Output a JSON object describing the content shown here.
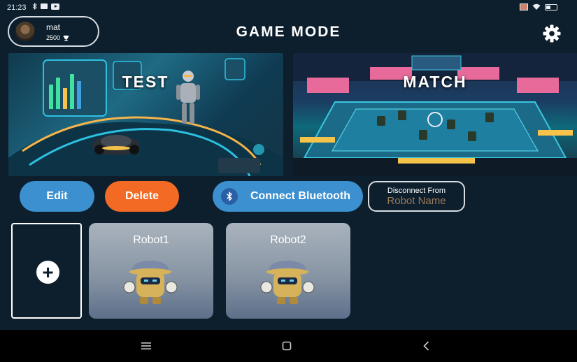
{
  "status_bar": {
    "time": "21:23"
  },
  "profile": {
    "name": "mat",
    "score": "2500"
  },
  "header": {
    "title": "GAME MODE"
  },
  "modes": [
    {
      "label": "TEST"
    },
    {
      "label": "MATCH"
    }
  ],
  "actions": {
    "edit_label": "Edit",
    "delete_label": "Delete",
    "connect_label": "Connect Bluetooth",
    "disconnect_label": "Disconnect From",
    "disconnect_target": "Robot Name"
  },
  "robots": [
    {
      "name": "Robot1"
    },
    {
      "name": "Robot2"
    }
  ],
  "colors": {
    "background": "#0d1f2d",
    "primary_button": "#3d90d0",
    "delete_button": "#f26a24",
    "robot_name_placeholder": "#9c7a5a"
  }
}
